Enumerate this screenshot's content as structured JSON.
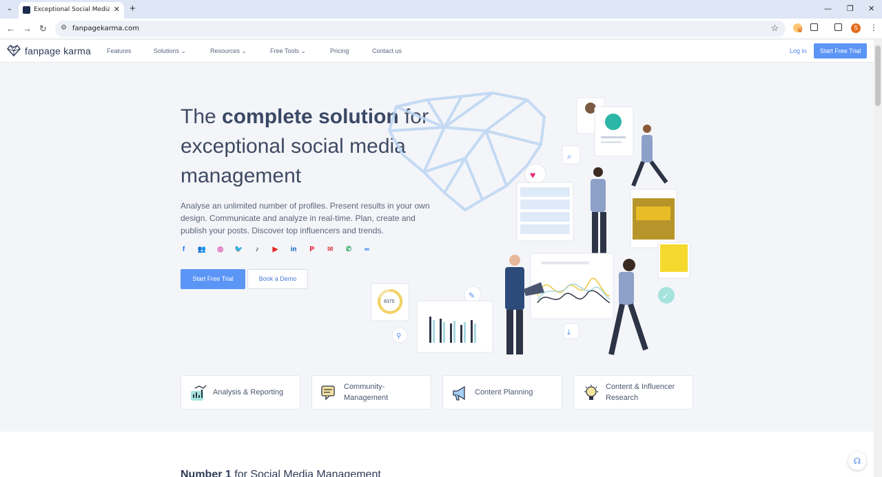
{
  "browser": {
    "tab_title": "Exceptional Social Media Ma",
    "url": "fanpagekarma.com",
    "new_tab": "+",
    "tab_close": "✕",
    "window_controls": [
      "—",
      "❐",
      "✕"
    ],
    "profile_initial": "S",
    "extension_badge": "5"
  },
  "header": {
    "logo": "fanpage karma",
    "nav": [
      {
        "label": "Features",
        "dropdown": false
      },
      {
        "label": "Solutions",
        "dropdown": true
      },
      {
        "label": "Resources",
        "dropdown": true
      },
      {
        "label": "Free Tools",
        "dropdown": true
      },
      {
        "label": "Pricing",
        "dropdown": false
      },
      {
        "label": "Contact us",
        "dropdown": false
      }
    ],
    "login": "Log in",
    "cta": "Start Free Trial"
  },
  "hero": {
    "title_pre": "The ",
    "title_bold": "complete solution",
    "title_rest": " for exceptional social media management",
    "subtitle": "Analyse an unlimited number of profiles. Present results in your own design. Communicate and analyze in real-time. Plan, create and publish your posts. Discover top influencers and trends.",
    "socials": [
      {
        "icon": "facebook-icon",
        "glyph": "f",
        "color": "#1877f2"
      },
      {
        "icon": "users-icon",
        "glyph": "👥",
        "color": "#2d7de0"
      },
      {
        "icon": "instagram-icon",
        "glyph": "◎",
        "color": "#d6249f"
      },
      {
        "icon": "twitter-icon",
        "glyph": "🐦",
        "color": "#1da1f2"
      },
      {
        "icon": "tiktok-icon",
        "glyph": "♪",
        "color": "#111111"
      },
      {
        "icon": "youtube-icon",
        "glyph": "▶",
        "color": "#e02424"
      },
      {
        "icon": "linkedin-icon",
        "glyph": "in",
        "color": "#0a66c2"
      },
      {
        "icon": "pinterest-icon",
        "glyph": "P",
        "color": "#e60023"
      },
      {
        "icon": "mail-icon",
        "glyph": "✉",
        "color": "#d94c4c"
      },
      {
        "icon": "whatsapp-icon",
        "glyph": "✆",
        "color": "#25a35a"
      },
      {
        "icon": "meta-icon",
        "glyph": "∞",
        "color": "#1877f2"
      }
    ],
    "primary_button": "Start Free Trial",
    "secondary_button": "Book a Demo",
    "widget_value": "8375"
  },
  "features": [
    {
      "label": "Analysis & Reporting",
      "icon": "analysis-icon"
    },
    {
      "label": "Community-\nManagement",
      "icon": "chat-icon"
    },
    {
      "label": "Content Planning",
      "icon": "megaphone-icon"
    },
    {
      "label": "Content & Influencer\nResearch",
      "icon": "lightbulb-icon"
    }
  ],
  "section": {
    "title_bold": "Number 1",
    "title_rest": " for Social Media Management"
  }
}
